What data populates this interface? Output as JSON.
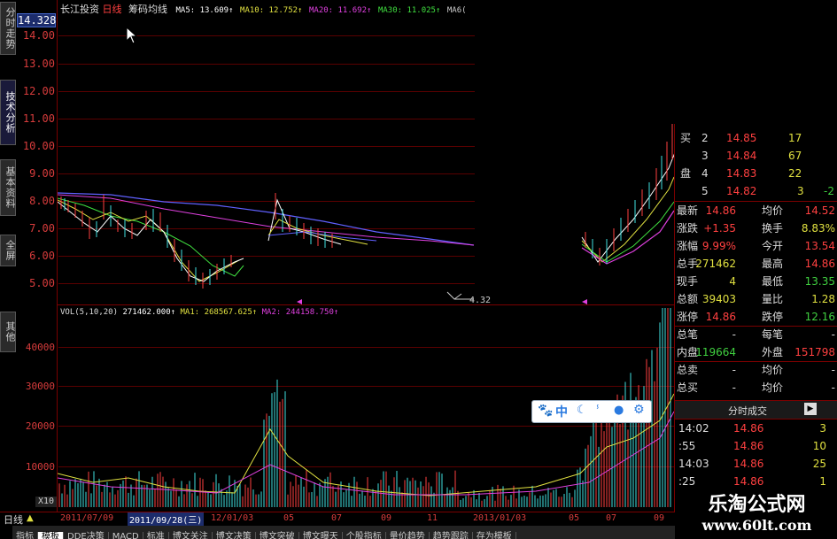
{
  "header": {
    "stock_name": "长江投资",
    "period": "日线",
    "indicator": "筹码均线",
    "ma5": "MA5: 13.609↑",
    "ma10": "MA10: 12.752↑",
    "ma20": "MA20: 11.692↑",
    "ma30": "MA30: 11.025↑",
    "ma60": "MA6("
  },
  "current_price_box": "14.328",
  "left_tabs": [
    "分时走势",
    "技术分析",
    "基本资料",
    "全屏",
    "其他"
  ],
  "price_axis": [
    "14.00",
    "13.00",
    "12.00",
    "11.00",
    "10.00",
    "9.00",
    "8.00",
    "7.00",
    "6.00",
    "5.00"
  ],
  "min_label": "4.32",
  "volume_header": {
    "label": "VOL(5,10,20)",
    "value": "271462.000↑",
    "ma1": "MA1: 268567.625↑",
    "ma2": "MA2: 244158.750↑"
  },
  "volume_axis": [
    "40000",
    "30000",
    "20000",
    "10000"
  ],
  "volume_unit": "X10",
  "date_bar": {
    "period_label": "日线",
    "dates": [
      "2011/07/09",
      "2011/09/28(三)",
      "12/01/03",
      "05",
      "07",
      "09",
      "11",
      "2013/01/03",
      "05",
      "07",
      "09"
    ]
  },
  "bottom_tabs": [
    "指标",
    "模板",
    "DDE决策",
    "MACD",
    "标准",
    "博文关注",
    "博文决策",
    "博文突破",
    "博文曝天",
    "个股指标",
    "量价趋势",
    "趋势跟踪",
    "存为模板"
  ],
  "order_book": [
    {
      "side": "买",
      "level": "2",
      "price": "14.85",
      "vol": "17"
    },
    {
      "side": "",
      "level": "3",
      "price": "14.84",
      "vol": "67"
    },
    {
      "side": "盘",
      "level": "4",
      "price": "14.83",
      "vol": "22"
    },
    {
      "side": "",
      "level": "5",
      "price": "14.82",
      "vol": "3",
      "extra": "-2"
    }
  ],
  "quote": [
    {
      "l1": "最新",
      "v1": "14.86",
      "l2": "均价",
      "v2": "14.52"
    },
    {
      "l1": "涨跌",
      "v1": "+1.35",
      "l2": "换手",
      "v2": "8.83%"
    },
    {
      "l1": "涨幅",
      "v1": "9.99%",
      "l2": "今开",
      "v2": "13.54"
    },
    {
      "l1": "总手",
      "v1": "271462",
      "l2": "最高",
      "v2": "14.86"
    },
    {
      "l1": "现手",
      "v1": "4",
      "l2": "最低",
      "v2": "13.35"
    },
    {
      "l1": "总额",
      "v1": "39403",
      "l2": "量比",
      "v2": "1.28"
    },
    {
      "l1": "涨停",
      "v1": "14.86",
      "l2": "跌停",
      "v2": "12.16"
    },
    {
      "l1": "总笔",
      "v1": "-",
      "l2": "每笔",
      "v2": "-"
    },
    {
      "l1": "内盘",
      "v1": "119664",
      "l2": "外盘",
      "v2": "151798"
    },
    {
      "l1": "总卖",
      "v1": "-",
      "l2": "均价",
      "v2": "-"
    },
    {
      "l1": "总买",
      "v1": "-",
      "l2": "均价",
      "v2": "-"
    }
  ],
  "ticks_header": "分时成交",
  "ticks_btn": "▶",
  "ticks": [
    {
      "time": "14:02",
      "price": "14.86",
      "vol": "3"
    },
    {
      "time": ":55",
      "price": "14.86",
      "vol": "10"
    },
    {
      "time": "14:03",
      "price": "14.86",
      "vol": "25"
    },
    {
      "time": ":25",
      "price": "14.86",
      "vol": "1"
    }
  ],
  "float_toolbar": {
    "zh": "中"
  },
  "watermark": {
    "title": "乐淘公式网",
    "url": "www.60lt.com"
  },
  "colors": {
    "up": "#ff4040",
    "down": "#40d040",
    "axis": "#d83c3c",
    "grid": "#5a0000",
    "ma5": "#ffffff",
    "ma10": "#e0e040",
    "ma20": "#e040e0",
    "ma30": "#40e040",
    "ma60": "#6060ff"
  }
}
